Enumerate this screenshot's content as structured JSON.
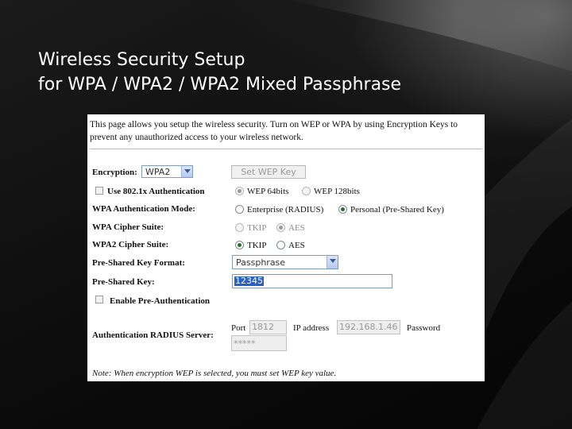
{
  "slide": {
    "title_line1": "Wireless Security Setup",
    "title_line2": "for WPA / WPA2 / WPA2 Mixed Passphrase"
  },
  "panel": {
    "intro": "This page allows you setup the wireless security. Turn on WEP or WPA by using Encryption Keys to prevent any unauthorized access to your wireless network.",
    "encryption": {
      "label": "Encryption:",
      "value": "WPA2",
      "set_wep_key_label": "Set WEP Key"
    },
    "use_8021x": {
      "label": "Use 802.1x Authentication",
      "checked": false
    },
    "wep_64": {
      "label": "WEP 64bits",
      "selected": true
    },
    "wep_128": {
      "label": "WEP 128bits",
      "selected": false
    },
    "wpa_auth_mode": {
      "label": "WPA Authentication Mode:",
      "enterprise_label": "Enterprise (RADIUS)",
      "personal_label": "Personal (Pre-Shared Key)",
      "selected": "personal"
    },
    "wpa_cipher": {
      "label": "WPA Cipher Suite:",
      "tkip_label": "TKIP",
      "aes_label": "AES",
      "selected": "aes"
    },
    "wpa2_cipher": {
      "label": "WPA2 Cipher Suite:",
      "tkip_label": "TKIP",
      "aes_label": "AES",
      "selected": "tkip"
    },
    "psk_format": {
      "label": "Pre-Shared Key Format:",
      "value": "Passphrase"
    },
    "psk": {
      "label": "Pre-Shared Key:",
      "value": "12345"
    },
    "pre_auth": {
      "label": "Enable Pre-Authentication",
      "checked": false
    },
    "radius": {
      "label": "Authentication RADIUS Server:",
      "port_label": "Port",
      "port_value": "1812",
      "ip_label": "IP address",
      "ip_value": "192.168.1.46",
      "password_label": "Password",
      "password_value": "*****"
    },
    "note": "Note: When encryption WEP is selected, you must set WEP key value."
  }
}
